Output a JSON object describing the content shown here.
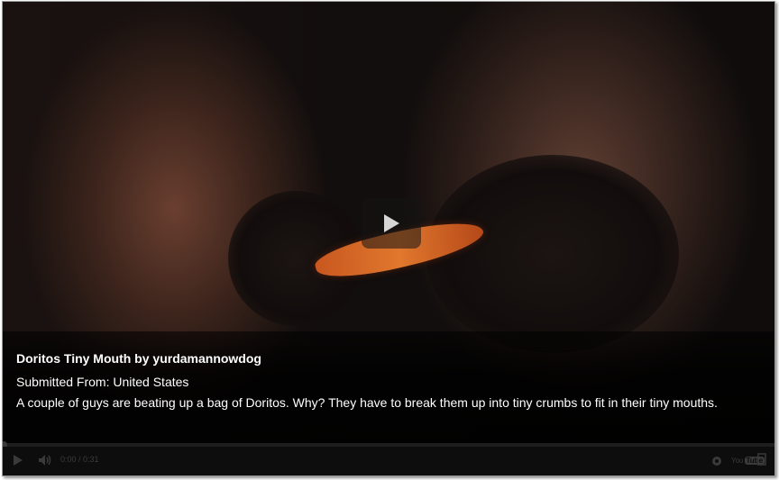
{
  "video": {
    "title": "Doritos Tiny Mouth by yurdamannowdog",
    "submitted_from": "Submitted From: United States",
    "description": "A couple of guys are beating up a bag of Doritos. Why? They have to break them up into tiny crumbs to fit in their tiny mouths."
  },
  "player": {
    "time": "0:00 / 0:31",
    "progress_fraction": 0,
    "brand_prefix": "You",
    "brand_suffix": "Tube"
  }
}
